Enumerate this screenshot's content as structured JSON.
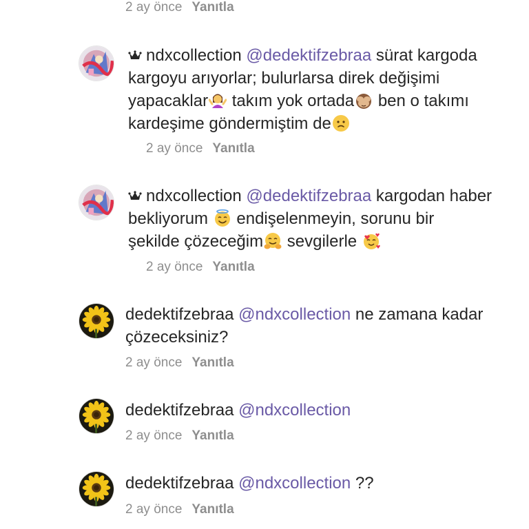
{
  "top_meta": {
    "time": "2 ay önce",
    "reply": "Yanıtla"
  },
  "comments": [
    {
      "username": "ndxcollection",
      "mention": "@dedektifzebraa",
      "text_parts": [
        "sürat kargoda",
        "kargoyu arıyorlar; bulurlarsa direk değişimi",
        "yapacaklar",
        "takım yok ortada",
        "ben o takımı",
        "kardeşime göndermiştim de"
      ],
      "time": "2 ay önce",
      "reply": "Yanıtla"
    },
    {
      "username": "ndxcollection",
      "mention": "@dedektifzebraa",
      "text_parts": [
        "kargodan haber",
        "bekliyorum",
        "endişelenmeyin, sorunu bir",
        "şekilde çözeceğim",
        "sevgilerle"
      ],
      "time": "2 ay önce",
      "reply": "Yanıtla"
    },
    {
      "username": "dedektifzebraa",
      "mention": "@ndxcollection",
      "text_parts": [
        "ne zamana kadar",
        "çözeceksiniz?"
      ],
      "time": "2 ay önce",
      "reply": "Yanıtla"
    },
    {
      "username": "dedektifzebraa",
      "mention": "@ndxcollection",
      "text_parts": [],
      "time": "2 ay önce",
      "reply": "Yanıtla"
    },
    {
      "username": "dedektifzebraa",
      "mention": "@ndxcollection",
      "text_parts": [
        "??"
      ],
      "time": "2 ay önce",
      "reply": "Yanıtla"
    }
  ],
  "colors": {
    "mention": "#6a5aa6",
    "meta": "#8e8e8e",
    "text": "#262626"
  },
  "icons": [
    "crown-icon",
    "woman-shrugging-emoji",
    "see-no-evil-monkey-emoji",
    "confused-face-emoji",
    "smiling-face-with-halo-emoji",
    "hugging-face-emoji",
    "smiling-face-with-hearts-emoji",
    "sunflower-avatar",
    "collection-avatar"
  ]
}
